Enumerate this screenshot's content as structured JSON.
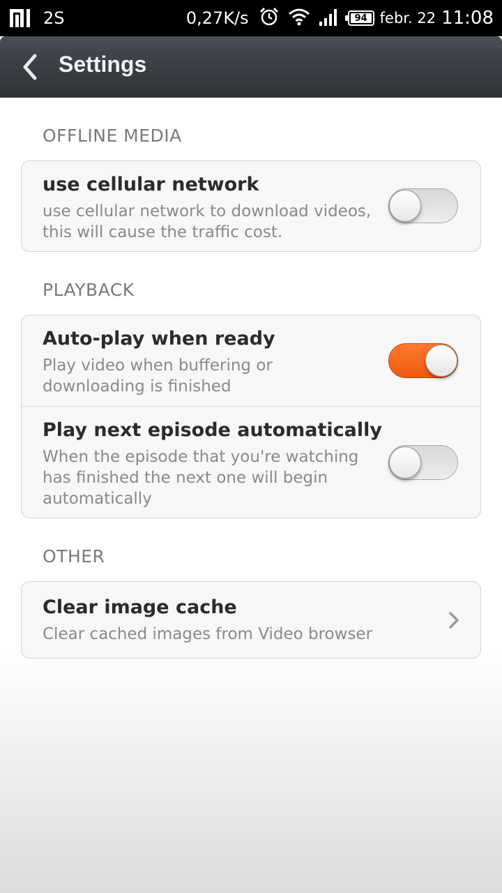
{
  "status_bar": {
    "model": "2S",
    "speed": "0,27K/s",
    "battery": "94",
    "date": "febr. 22",
    "time": "11:08",
    "icons": [
      "mi-logo-icon",
      "alarm-icon",
      "wifi-icon",
      "signal-icon",
      "battery-icon"
    ]
  },
  "header": {
    "title": "Settings",
    "back_icon": "chevron-left-icon"
  },
  "sections": [
    {
      "header": "OFFLINE MEDIA",
      "items": [
        {
          "title": "use cellular network",
          "subtitle": "use cellular network to download videos, this will cause the traffic cost.",
          "control": "toggle",
          "on": false
        }
      ]
    },
    {
      "header": "PLAYBACK",
      "items": [
        {
          "title": "Auto-play when ready",
          "subtitle": "Play video when buffering or downloading is finished",
          "control": "toggle",
          "on": true
        },
        {
          "title": "Play next episode automatically",
          "subtitle": "When the episode that you're watching has finished the next one will begin automatically",
          "control": "toggle",
          "on": false
        }
      ]
    },
    {
      "header": "OTHER",
      "items": [
        {
          "title": "Clear image cache",
          "subtitle": "Clear cached images from Video browser",
          "control": "chevron-right-icon"
        }
      ]
    }
  ],
  "colors": {
    "toggle_on": "#f26a1b",
    "toggle_off": "#e2e2e2",
    "actionbar": "#3d4146",
    "section_header": "#7a7a7a"
  }
}
